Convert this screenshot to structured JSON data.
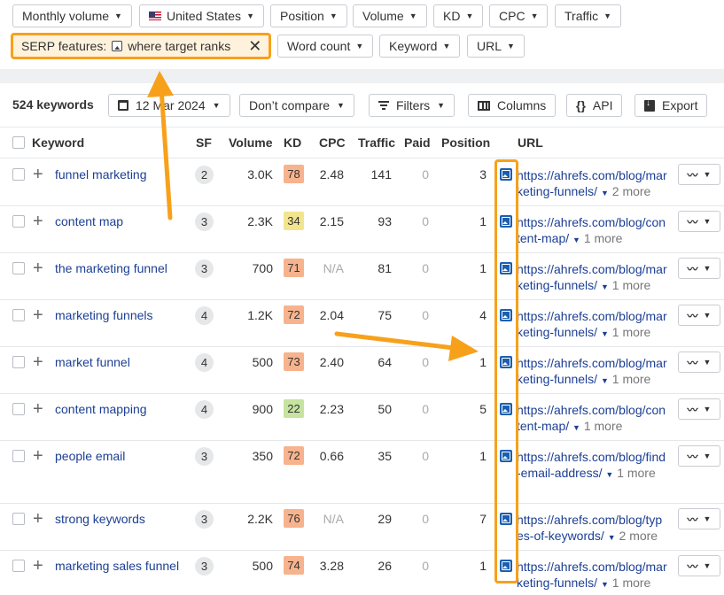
{
  "filters": {
    "monthly_volume": "Monthly volume",
    "country": "United States",
    "position": "Position",
    "volume": "Volume",
    "kd": "KD",
    "cpc": "CPC",
    "traffic": "Traffic",
    "serp_prefix": "SERP features:",
    "serp_suffix": "where target ranks",
    "word_count": "Word count",
    "keyword": "Keyword",
    "url": "URL"
  },
  "toolbar": {
    "count": "524 keywords",
    "date": "12 Mar 2024",
    "compare": "Don’t compare",
    "filters": "Filters",
    "columns": "Columns",
    "api": "API",
    "export": "Export"
  },
  "columns": {
    "keyword": "Keyword",
    "sf": "SF",
    "volume": "Volume",
    "kd": "KD",
    "cpc": "CPC",
    "traffic": "Traffic",
    "paid": "Paid",
    "position": "Position",
    "url": "URL"
  },
  "rows": [
    {
      "keyword": "funnel marketing",
      "sf": "2",
      "volume": "3.0K",
      "kd": "78",
      "kd_color": "#f7b38d",
      "cpc": "2.48",
      "traffic": "141",
      "paid": "0",
      "position": "3",
      "url": "https://ahrefs.com/blog/marketing-funnels/",
      "more": "2 more"
    },
    {
      "keyword": "content map",
      "sf": "3",
      "volume": "2.3K",
      "kd": "34",
      "kd_color": "#f2e58e",
      "cpc": "2.15",
      "traffic": "93",
      "paid": "0",
      "position": "1",
      "url": "https://ahrefs.com/blog/content-map/",
      "more": "1 more"
    },
    {
      "keyword": "the marketing funnel",
      "sf": "3",
      "volume": "700",
      "kd": "71",
      "kd_color": "#f7b38d",
      "cpc": "N/A",
      "traffic": "81",
      "paid": "0",
      "position": "1",
      "url": "https://ahrefs.com/blog/marketing-funnels/",
      "more": "1 more"
    },
    {
      "keyword": "marketing funnels",
      "sf": "4",
      "volume": "1.2K",
      "kd": "72",
      "kd_color": "#f7b38d",
      "cpc": "2.04",
      "traffic": "75",
      "paid": "0",
      "position": "4",
      "url": "https://ahrefs.com/blog/marketing-funnels/",
      "more": "1 more"
    },
    {
      "keyword": "market funnel",
      "sf": "4",
      "volume": "500",
      "kd": "73",
      "kd_color": "#f7b38d",
      "cpc": "2.40",
      "traffic": "64",
      "paid": "0",
      "position": "1",
      "url": "https://ahrefs.com/blog/marketing-funnels/",
      "more": "1 more"
    },
    {
      "keyword": "content mapping",
      "sf": "4",
      "volume": "900",
      "kd": "22",
      "kd_color": "#c6e3a0",
      "cpc": "2.23",
      "traffic": "50",
      "paid": "0",
      "position": "5",
      "url": "https://ahrefs.com/blog/content-map/",
      "more": "1 more"
    },
    {
      "keyword": "people email",
      "sf": "3",
      "volume": "350",
      "kd": "72",
      "kd_color": "#f7b38d",
      "cpc": "0.66",
      "traffic": "35",
      "paid": "0",
      "position": "1",
      "url": "https://ahrefs.com/blog/find-email-address/",
      "more": "1 more"
    },
    {
      "keyword": "strong keywords",
      "sf": "3",
      "volume": "2.2K",
      "kd": "76",
      "kd_color": "#f7b38d",
      "cpc": "N/A",
      "traffic": "29",
      "paid": "0",
      "position": "7",
      "url": "https://ahrefs.com/blog/types-of-keywords/",
      "more": "2 more"
    },
    {
      "keyword": "marketing sales funnel",
      "sf": "3",
      "volume": "500",
      "kd": "74",
      "kd_color": "#f7b38d",
      "cpc": "3.28",
      "traffic": "26",
      "paid": "0",
      "position": "1",
      "url": "https://ahrefs.com/blog/marketing-funnels/",
      "more": "1 more"
    }
  ],
  "accent": "#f7a11b",
  "link_color": "#1c3f94"
}
